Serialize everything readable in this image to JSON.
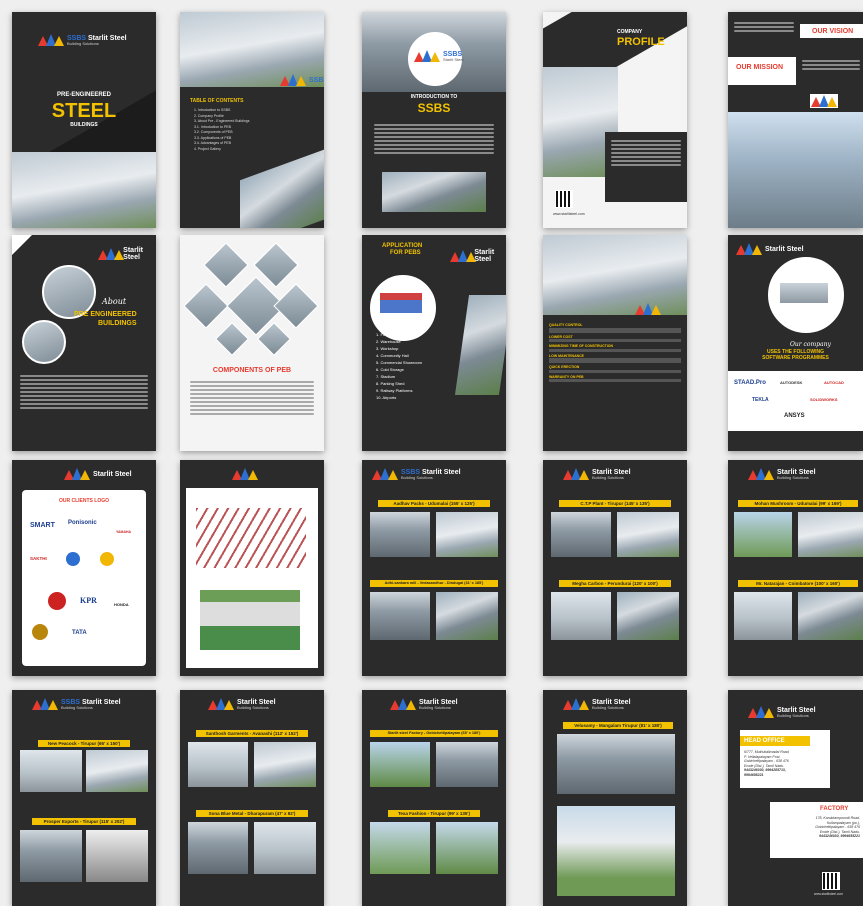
{
  "brand": {
    "short": "SSBS",
    "name": "Starlit Steel",
    "tagline": "Building Solutions",
    "colors": {
      "accent": "#f2c200",
      "red": "#e63b2e",
      "blue": "#2d6fd1",
      "dark": "#2b2b2b"
    }
  },
  "cover": {
    "line1": "PRE-ENGINEERED",
    "line2": "STEEL",
    "line3": "BUILDINGS"
  },
  "toc": {
    "title": "TABLE OF CONTENTS",
    "items": [
      "1. Introduction to SSBS",
      "2. Company Profile",
      "3. About Pre - Engineered Buildings",
      "3.1. Introduction to PEB",
      "3.2. Components of PEB",
      "3.3. Applications of PEB",
      "3.4. Advantages of PEB",
      "4. Project Gallery"
    ]
  },
  "intro": {
    "title1": "INTRODUCTION TO",
    "title2": "SSBS"
  },
  "profile": {
    "title1": "COMPANY",
    "title2": "PROFILE",
    "website": "www.starlitsteel.com"
  },
  "vision": {
    "vision": "OUR VISION",
    "mission": "OUR MISSION"
  },
  "about": {
    "script": "About",
    "line1": "PRE ENGINEERED",
    "line2": "BUILDINGS"
  },
  "components": {
    "title": "COMPONENTS OF PEB"
  },
  "applications": {
    "title1": "APPLICATION",
    "title2": "FOR PEBS",
    "items": [
      "1. Factory",
      "2. Warehouse",
      "3. Workshop",
      "4. Community Hall",
      "5. Commercial Showroom",
      "6. Cold Storage",
      "7. Stadium",
      "8. Parking Shed",
      "9. Railway Platforms",
      "10. Airports"
    ]
  },
  "advantages": {
    "items": [
      "QUALITY CONTROL",
      "LOWER COST",
      "MINIMIZING TIME OF CONSTRUCTION",
      "LOW MAINTENANCE",
      "QUICK ERECTION",
      "WARRANTY ON PEB"
    ]
  },
  "software": {
    "script": "Our company",
    "line1": "USES THE FOLLOWING",
    "line2": "SOFTWARE PROGRAMMES",
    "logos": [
      "STAAD.Pro",
      "AUTODESK",
      "AUTOCAD",
      "TEKLA",
      "SOLIDWORKS",
      "ANSYS"
    ]
  },
  "clients": {
    "title": "OUR CLIENTS LOGO",
    "logos": [
      "SMART",
      "Ponisonic",
      "YAMAHA",
      "SAKTHI",
      "KPR",
      "HONDA",
      "TATA"
    ]
  },
  "projects": [
    "Aadhav Packs - Udumalai (155' x 125')",
    "Adhi-sankara mill - Vedasandhur - Dindugal (31' x 185')",
    "C.T.P Plant - Tirupur (145' x 135')",
    "Megha Carbon - Perundurai (120' x 100')",
    "Mohan Mushroom - Udumalai (99' x 169')",
    "Mr. Natarajan - Coimbatore (100' x 160')",
    "New Peacock - Tirupur (65' x 150')",
    "Prosper Exports - Tirupur (115' x 202')",
    "Santhosh Garments - Avanashi (112' x 152')",
    "Sona Blue Metal - Dharapuram (47' x 92')",
    "Starlit steel Factory - Gobichettipalayam (65' x 180')",
    "Texa Fashion - Tirupur (99' x 135')",
    "Velusamy - Mangalam Tirupur (81' x 180')"
  ],
  "contact": {
    "head_title": "HEAD OFFICE",
    "head_lines": [
      "6/777, Muthukalimadai Road,",
      "P. Vellalapalayam Post,",
      "Gobichettipalayam - 638 476",
      "Erode (Dist.), Tamil Nadu.",
      "9443246030, 9994285713,",
      "9994655221"
    ],
    "factory_title": "FACTORY",
    "factory_lines": [
      "178, Karukkampoondi Road,",
      "Kullampalayam (po.),",
      "Gobichettipalayam - 638 476",
      "Erode (Dist.), Tamil Nadu.",
      "9443246030, 9994655221"
    ],
    "website": "www.starlitsteel.com"
  }
}
